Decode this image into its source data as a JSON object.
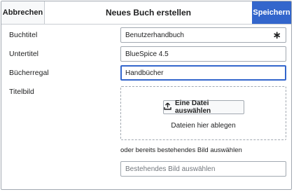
{
  "dialog": {
    "title": "Neues Buch erstellen",
    "cancel_label": "Abbrechen",
    "save_label": "Speichern"
  },
  "form": {
    "book_title": {
      "label": "Buchtitel",
      "value": "Benutzerhandbuch",
      "required_mark": "∗"
    },
    "subtitle": {
      "label": "Untertitel",
      "value": "BlueSpice 4.5"
    },
    "bookshelf": {
      "label": "Bücherregal",
      "value": "Handbücher"
    },
    "cover_image": {
      "label": "Titelbild",
      "upload_button": "Eine Datei auswählen",
      "drop_text": "Dateien hier ablegen",
      "existing_text": "oder bereits bestehendes Bild auswählen",
      "existing_placeholder": "Bestehendes Bild auswählen"
    }
  },
  "colors": {
    "accent": "#3366cc",
    "border": "#a2a9b1"
  },
  "icons": {
    "upload": "upload-icon"
  }
}
